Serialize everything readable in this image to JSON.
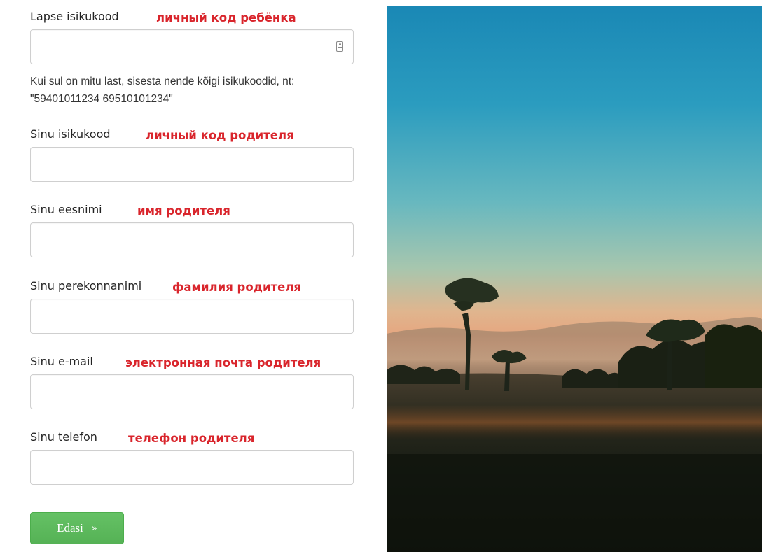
{
  "fields": [
    {
      "label": "Lapse isikukood",
      "annotation": "личный код ребёнка",
      "value": "",
      "icon": "contact-card-icon"
    },
    {
      "label": "Sinu isikukood",
      "annotation": "личный код родителя",
      "value": ""
    },
    {
      "label": "Sinu eesnimi",
      "annotation": "имя родителя",
      "value": ""
    },
    {
      "label": "Sinu perekonnanimi",
      "annotation": "фамилия родителя",
      "value": ""
    },
    {
      "label": "Sinu e-mail",
      "annotation": "электронная почта родителя",
      "value": ""
    },
    {
      "label": "Sinu telefon",
      "annotation": "телефон родителя",
      "value": ""
    }
  ],
  "help_text": "Kui sul on mitu last, sisesta nende kõigi isikukoodid, nt: \"59401011234 69510101234\"",
  "next_button": {
    "label": "Edasi",
    "chevron": "»"
  },
  "colors": {
    "annotation": "#d9252c",
    "button": "#5cb85c",
    "input_border": "#cfcfcf"
  }
}
